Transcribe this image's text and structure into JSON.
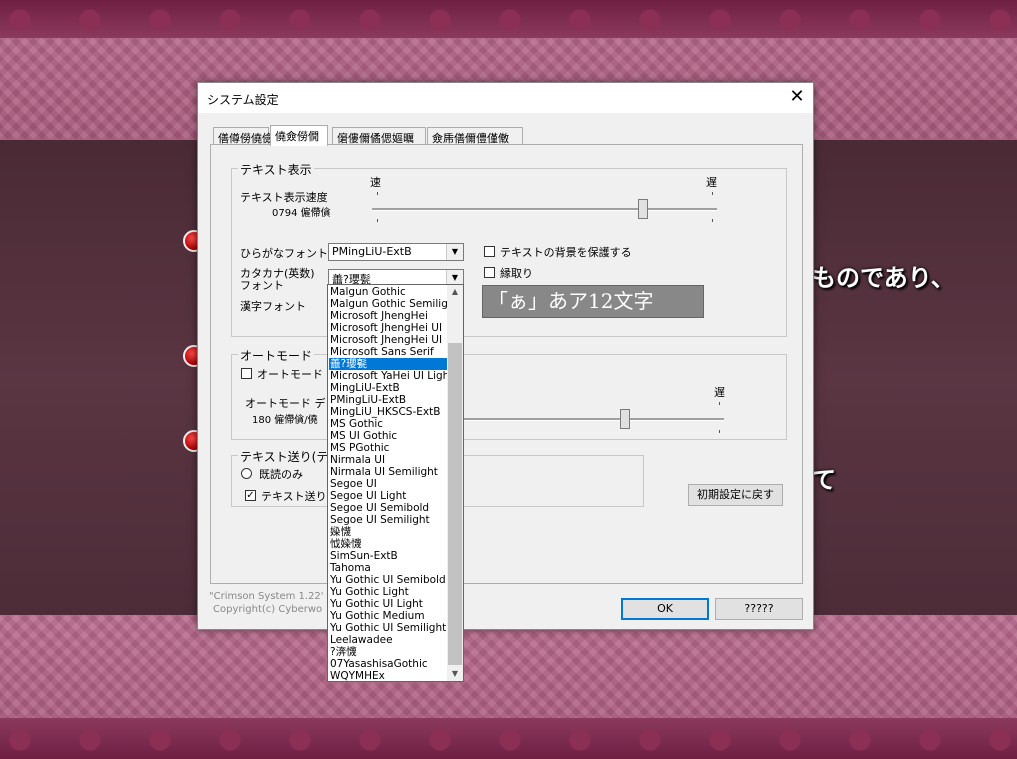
{
  "background": {
    "lines": [
      "ものであり、",
      "て"
    ]
  },
  "dialog": {
    "title": "システム設定",
    "close_label": "✕",
    "tabs": [
      {
        "label": "僐僔僗僥儉"
      },
      {
        "label": "僥僉僗僩"
      },
      {
        "label": "僒僂儞僪偲嫗曞"
      },
      {
        "label": "僉乕僐儞僼僅僌"
      }
    ],
    "text_group": {
      "label": "テキスト表示",
      "speed_label": "テキスト表示速度",
      "speed_value": "0794 僱僀僋",
      "fast_label": "速",
      "slow_label": "遅",
      "hiragana_font_label": "ひらがなフォント",
      "hiragana_font_value": "PMingLiU-ExtB",
      "katakana_font_label_1": "カタカナ(英数)",
      "katakana_font_label_2": "フォント",
      "katakana_font_value": "譱?瓔甏",
      "kanji_font_label": "漢字フォント",
      "bg_protect_label": "テキストの背景を保護する",
      "border_label": "縁取り",
      "preview_text": "「ぁ」あア12文字"
    },
    "auto_group": {
      "label": "オートモード",
      "auto_checkbox_label": "オートモード O",
      "wait_label": "オートモード デ",
      "wait_value": "180 僱僀僋/僥",
      "slow_label": "遅"
    },
    "send_group": {
      "label": "テキスト送り(テキ",
      "read_only_label": "既読のみ",
      "send_checkbox_label": "テキスト送り時"
    },
    "reset_button": "初期設定に戻す",
    "ok_button": "OK",
    "cancel_button": "?????",
    "footer_line1": "\"Crimson System 1.22'",
    "footer_line2": "Copyright(c) Cyberwo"
  },
  "font_list": {
    "items": [
      "Malgun Gothic",
      "Malgun Gothic Semiligh",
      "Microsoft JhengHei",
      "Microsoft JhengHei UI",
      "Microsoft JhengHei UI",
      "Microsoft Sans Serif",
      "譱?瓔甏",
      "Microsoft YaHei UI Ligh",
      "MingLiU-ExtB",
      "PMingLiU-ExtB",
      "MingLiU_HKSCS-ExtB",
      "MS Gothic",
      "MS UI Gothic",
      "MS PGothic",
      "Nirmala UI",
      "Nirmala UI Semilight",
      "Segoe UI",
      "Segoe UI Light",
      "Segoe UI Semibold",
      "Segoe UI Semilight",
      "媣懱",
      "怴媣懱",
      "SimSun-ExtB",
      "Tahoma",
      "Yu Gothic UI Semibold",
      "Yu Gothic Light",
      "Yu Gothic UI Light",
      "Yu Gothic Medium",
      "Yu Gothic UI Semilight",
      "Leelawadee",
      "?渀懱",
      "07YasashisaGothic",
      "WQYMHEx"
    ],
    "selected_index": 6
  },
  "colors": {
    "selection": "#0078d7",
    "bullet": "#cc0000"
  },
  "icons": {
    "scroll_up": "▲",
    "scroll_down": "▼",
    "combo_arrow": "▼",
    "check": "✓"
  }
}
